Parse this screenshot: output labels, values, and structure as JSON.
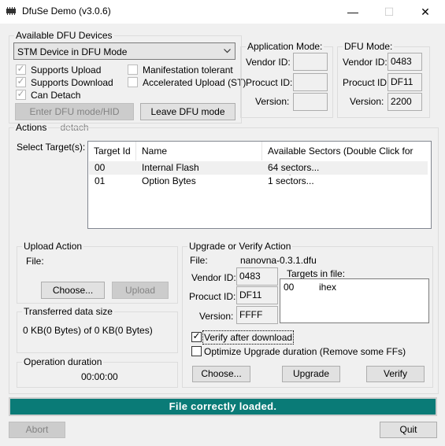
{
  "window": {
    "title": "DfuSe Demo (v3.0.6)",
    "minimize": "—",
    "maximize": "☐",
    "close": "✕",
    "app_icon": "chip-icon"
  },
  "dfu_devices": {
    "legend": "Available DFU Devices",
    "selected_device": "STM Device in DFU Mode",
    "checks": {
      "supports_upload": "Supports Upload",
      "supports_download": "Supports Download",
      "can_detach": "Can Detach",
      "manifestation_tolerant": "Manifestation tolerant",
      "accelerated_upload": "Accelerated Upload (ST)"
    },
    "enter_dfu_button": "Enter DFU mode/HID detach",
    "leave_dfu_button": "Leave DFU mode"
  },
  "app_mode": {
    "legend": "Application Mode:",
    "vendor_id_label": "Vendor ID:",
    "product_id_label": "Procuct ID:",
    "version_label": "Version:",
    "vendor_id": "",
    "product_id": "",
    "version": ""
  },
  "dfu_mode": {
    "legend": "DFU Mode:",
    "vendor_id_label": "Vendor ID:",
    "product_id_label": "Procuct ID:",
    "version_label": "Version:",
    "vendor_id": "0483",
    "product_id": "DF11",
    "version": "2200"
  },
  "actions": {
    "legend": "Actions",
    "select_targets_label": "Select Target(s):",
    "columns": [
      "Target Id",
      "Name",
      "Available Sectors (Double Click for more)"
    ],
    "rows": [
      {
        "id": "00",
        "name": "Internal Flash",
        "sectors": "64 sectors..."
      },
      {
        "id": "01",
        "name": "Option Bytes",
        "sectors": "1 sectors..."
      }
    ]
  },
  "upload": {
    "legend": "Upload Action",
    "file_label": "File:",
    "choose_button": "Choose...",
    "upload_button": "Upload"
  },
  "transferred": {
    "legend": "Transferred data size",
    "value": "0 KB(0 Bytes) of 0 KB(0 Bytes)"
  },
  "duration": {
    "legend": "Operation duration",
    "value": "00:00:00"
  },
  "upgrade": {
    "legend": "Upgrade or Verify Action",
    "file_label": "File:",
    "file_name": "nanovna-0.3.1.dfu",
    "vendor_id_label": "Vendor ID:",
    "product_id_label": "Procuct ID:",
    "version_label": "Version:",
    "vendor_id": "0483",
    "product_id": "DF11",
    "version": "FFFF",
    "targets_in_file_label": "Targets in file:",
    "targets": [
      {
        "id": "00",
        "name": "ihex"
      }
    ],
    "verify_after_download": "Verify after download",
    "optimize_upgrade": "Optimize Upgrade duration (Remove some FFs)",
    "choose_button": "Choose...",
    "upgrade_button": "Upgrade",
    "verify_button": "Verify"
  },
  "status": {
    "message": "File correctly loaded.",
    "color": "#0a7b77"
  },
  "footer": {
    "abort_button": "Abort",
    "quit_button": "Quit"
  }
}
